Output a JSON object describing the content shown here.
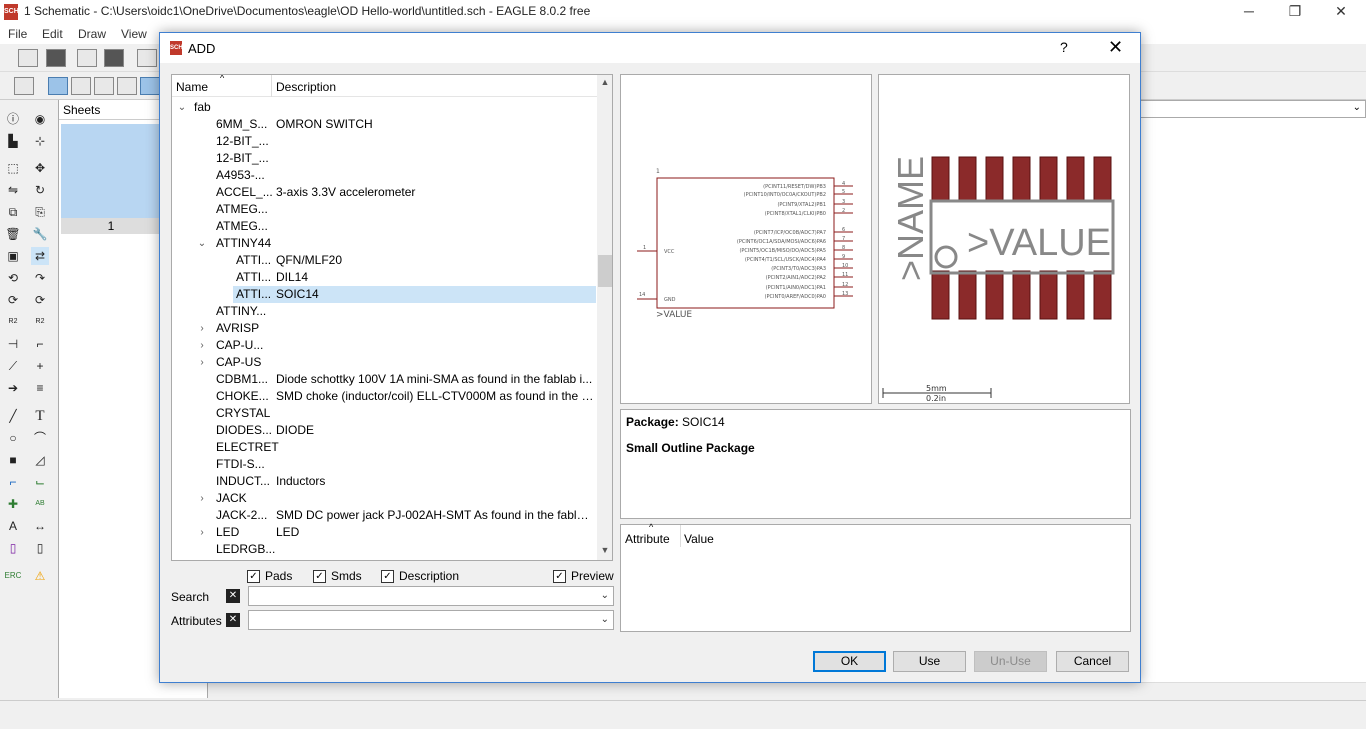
{
  "window": {
    "title": "1 Schematic - C:\\Users\\oidc1\\OneDrive\\Documentos\\eagle\\OD Hello-world\\untitled.sch - EAGLE 8.0.2 free",
    "app_icon": "SCH"
  },
  "menu": [
    "File",
    "Edit",
    "Draw",
    "View"
  ],
  "sheets": {
    "header": "Sheets",
    "number": "1"
  },
  "dialog": {
    "title": "ADD",
    "icon": "SCH",
    "help": "?",
    "close": "✕",
    "tree": {
      "col_name": "Name",
      "col_description": "Description",
      "rows": [
        {
          "name": "fab",
          "desc": "",
          "level": 0,
          "expander": "⌄"
        },
        {
          "name": "6MM_S...",
          "desc": "OMRON SWITCH",
          "level": 1,
          "expander": ""
        },
        {
          "name": "12-BIT_...",
          "desc": "",
          "level": 1,
          "expander": ""
        },
        {
          "name": "12-BIT_...",
          "desc": "",
          "level": 1,
          "expander": ""
        },
        {
          "name": "A4953-...",
          "desc": "",
          "level": 1,
          "expander": ""
        },
        {
          "name": "ACCEL_...",
          "desc": "3-axis 3.3V accelerometer",
          "level": 1,
          "expander": ""
        },
        {
          "name": "ATMEG...",
          "desc": "",
          "level": 1,
          "expander": ""
        },
        {
          "name": "ATMEG...",
          "desc": "",
          "level": 1,
          "expander": ""
        },
        {
          "name": "ATTINY44",
          "desc": "",
          "level": 1,
          "expander": "⌄"
        },
        {
          "name": "ATTI...",
          "desc": "QFN/MLF20",
          "level": 2,
          "expander": ""
        },
        {
          "name": "ATTI...",
          "desc": "DIL14",
          "level": 2,
          "expander": ""
        },
        {
          "name": "ATTI...",
          "desc": "SOIC14",
          "level": 2,
          "expander": "",
          "selected": true
        },
        {
          "name": "ATTINY...",
          "desc": "",
          "level": 1,
          "expander": ""
        },
        {
          "name": "AVRISP",
          "desc": "",
          "level": 1,
          "expander": "›"
        },
        {
          "name": "CAP-U...",
          "desc": "",
          "level": 1,
          "expander": "›"
        },
        {
          "name": "CAP-US",
          "desc": "",
          "level": 1,
          "expander": "›"
        },
        {
          "name": "CDBM1...",
          "desc": "Diode schottky 100V 1A mini-SMA as found in the fablab i...",
          "level": 1,
          "expander": ""
        },
        {
          "name": "CHOKE...",
          "desc": "SMD choke (inductor/coil) ELL-CTV000M as found in the f...",
          "level": 1,
          "expander": ""
        },
        {
          "name": "CRYSTAL",
          "desc": "",
          "level": 1,
          "expander": ""
        },
        {
          "name": "DIODES...",
          "desc": "DIODE",
          "level": 1,
          "expander": ""
        },
        {
          "name": "ELECTRET",
          "desc": "",
          "level": 1,
          "expander": ""
        },
        {
          "name": "FTDI-S...",
          "desc": "",
          "level": 1,
          "expander": ""
        },
        {
          "name": "INDUCT...",
          "desc": "Inductors",
          "level": 1,
          "expander": ""
        },
        {
          "name": "JACK",
          "desc": "",
          "level": 1,
          "expander": "›"
        },
        {
          "name": "JACK-2...",
          "desc": "SMD DC power jack PJ-002AH-SMT As found in the fablab...",
          "level": 1,
          "expander": ""
        },
        {
          "name": "LED",
          "desc": "LED",
          "level": 1,
          "expander": "›"
        },
        {
          "name": "LEDRGB...",
          "desc": "",
          "level": 1,
          "expander": ""
        }
      ]
    },
    "checkboxes": {
      "pads": "Pads",
      "smds": "Smds",
      "description": "Description",
      "preview": "Preview",
      "check": "✓"
    },
    "search_label": "Search",
    "attributes_label": "Attributes",
    "symbol": {
      "pins_right": [
        {
          "label": "(PCINT11/RESET/DW)PB3",
          "num": "4"
        },
        {
          "label": "(PCINT10/INT0/OC0A/CKOUT)PB2",
          "num": "5"
        },
        {
          "label": "(PCINT9/XTAL2)PB1",
          "num": "3"
        },
        {
          "label": "(PCINT8/XTAL1/CLKI)PB0",
          "num": "2"
        },
        {
          "label": "(PCINT7/ICP/OC0B/ADC7)PA7",
          "num": "6"
        },
        {
          "label": "(PCINT6/OC1A/SDA/MOSI/ADC6)PA6",
          "num": "7"
        },
        {
          "label": "(PCINT5/OC1B/MISO/DO/ADC5)PA5",
          "num": "8"
        },
        {
          "label": "(PCINT4/T1/SCL/USCK/ADC4)PA4",
          "num": "9"
        },
        {
          "label": "(PCINT3/T0/ADC3)PA3",
          "num": "10"
        },
        {
          "label": "(PCINT2/AIN1/ADC2)PA2",
          "num": "11"
        },
        {
          "label": "(PCINT1/AIN0/ADC1)PA1",
          "num": "12"
        },
        {
          "label": "(PCINT0/AREF/ADC0)PA0",
          "num": "13"
        }
      ],
      "vcc": "VCC",
      "vcc_num": "1",
      "gnd": "GND",
      "gnd_num": "14",
      "top_num": "1",
      "value": ">VALUE"
    },
    "package": {
      "name_label": ">NAME",
      "value_label": ">VALUE",
      "scale_mm": "5mm",
      "scale_in": "0.2in"
    },
    "info": {
      "package_label": "Package:",
      "package_value": "SOIC14",
      "description": "Small Outline Package"
    },
    "attributes": {
      "col_attribute": "Attribute",
      "col_value": "Value"
    },
    "buttons": {
      "ok": "OK",
      "use": "Use",
      "unuse": "Un-Use",
      "cancel": "Cancel"
    }
  }
}
